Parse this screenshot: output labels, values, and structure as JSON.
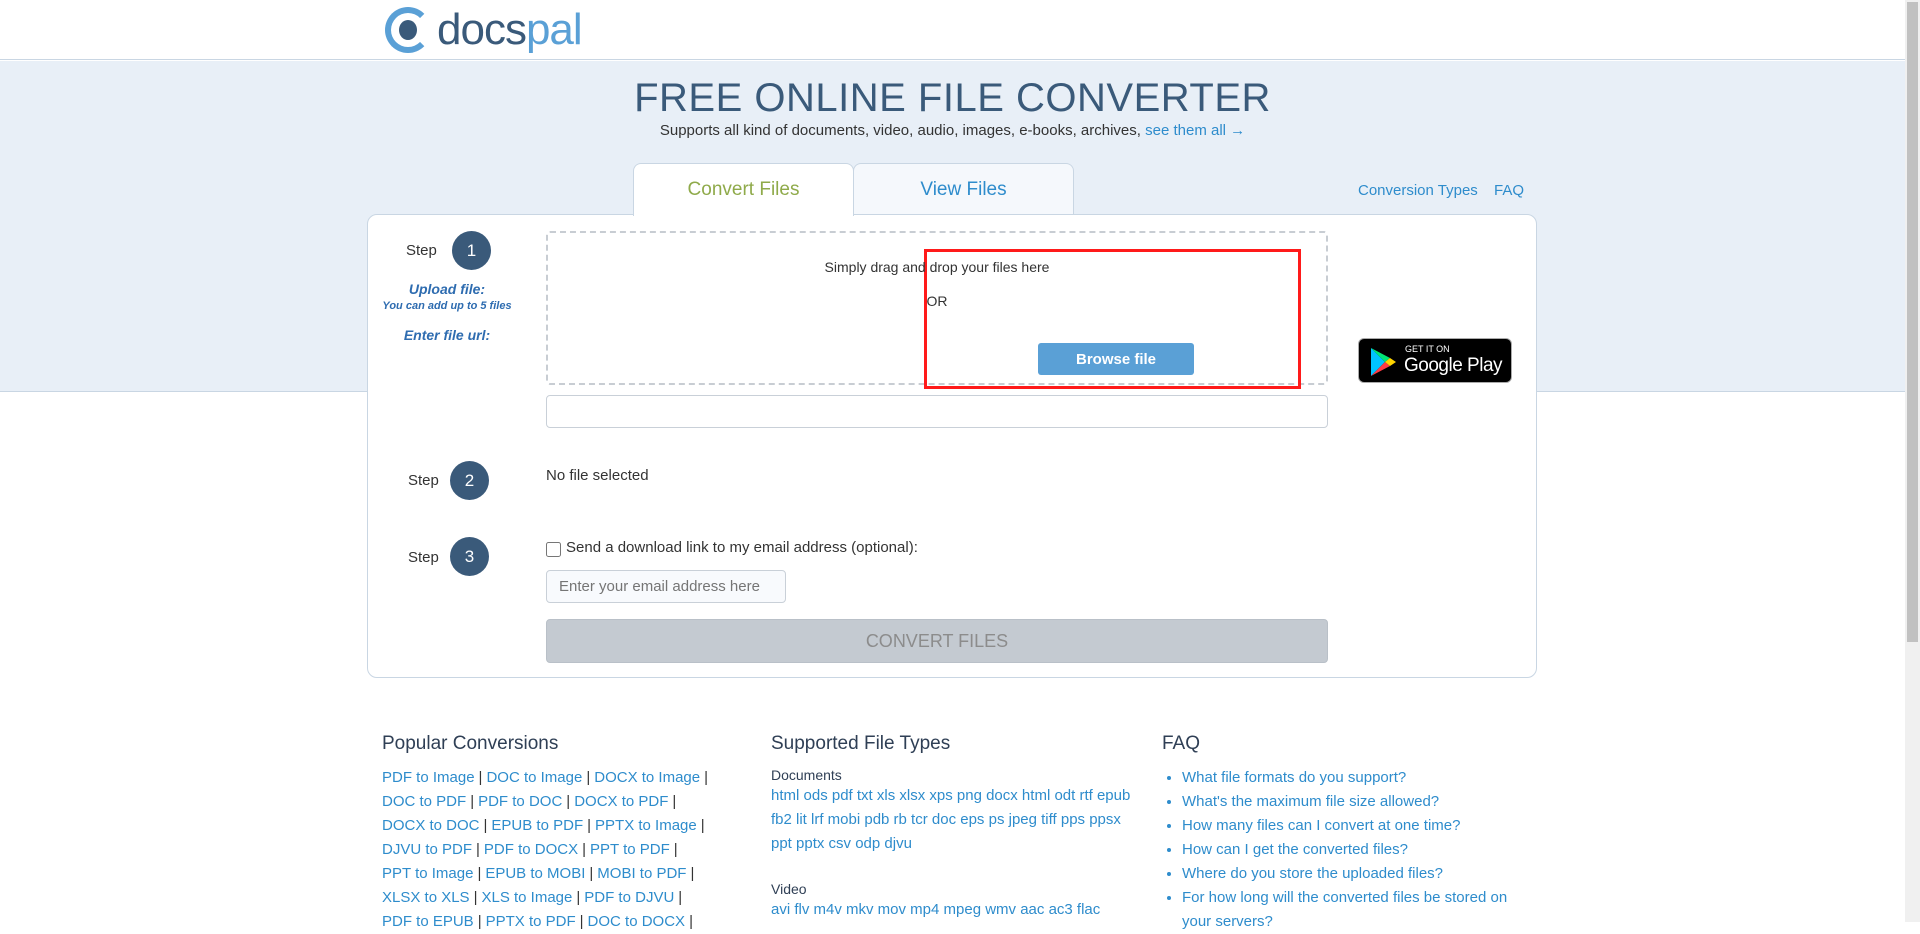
{
  "header": {
    "logo_text_dark": "docs",
    "logo_text_light": "pal"
  },
  "hero": {
    "title": "FREE ONLINE FILE CONVERTER",
    "subtitle": "Supports all kind of documents, video, audio, images, e-books, archives,",
    "see_all": "see them all →"
  },
  "tabs": [
    {
      "label": "Convert Files",
      "active": true
    },
    {
      "label": "View Files",
      "active": false
    }
  ],
  "top_links": [
    "Conversion Types",
    "FAQ"
  ],
  "steps": {
    "step_label": "Step",
    "numbers": [
      "1",
      "2",
      "3"
    ],
    "upload_label": "Upload file:",
    "upload_hint": "You can add up to 5 files",
    "drop_text": "Simply drag and drop your files here",
    "or_text": "OR",
    "browse_label": "Browse file",
    "url_label": "Enter file url:",
    "url_value": "",
    "no_file": "No file selected",
    "email_checkbox_label": "Send a download link to my email address (optional):",
    "email_checked": false,
    "email_placeholder": "Enter your email address here",
    "convert_label": "CONVERT FILES"
  },
  "google_play": {
    "small": "GET IT ON",
    "big": "Google Play"
  },
  "popular": {
    "heading": "Popular Conversions",
    "items": [
      "PDF to Image",
      "DOC to Image",
      "DOCX to Image",
      "DOC to PDF",
      "PDF to DOC",
      "DOCX to PDF",
      "DOCX to DOC",
      "EPUB to PDF",
      "PPTX to Image",
      "DJVU to PDF",
      "PDF to DOCX",
      "PPT to PDF",
      "PPT to Image",
      "EPUB to MOBI",
      "MOBI to PDF",
      "XLSX to XLS",
      "XLS to Image",
      "PDF to DJVU",
      "PDF to EPUB",
      "PPTX to PDF",
      "DOC to DOCX"
    ]
  },
  "file_types": {
    "heading": "Supported File Types",
    "documents_label": "Documents",
    "documents": "html ods pdf txt xls xlsx xps png docx html odt rtf epub fb2 lit lrf mobi pdb rb tcr doc eps ps jpeg tiff pps ppsx ppt pptx csv odp djvu",
    "video_label": "Video",
    "video": "avi flv m4v mkv mov mp4 mpeg wmv aac ac3 flac"
  },
  "faq": {
    "heading": "FAQ",
    "items": [
      "What file formats do you support?",
      "What's the maximum file size allowed?",
      "How many files can I convert at one time?",
      "How can I get the converted files?",
      "Where do you store the uploaded files?",
      "For how long will the converted files be stored on your servers?"
    ]
  },
  "colors": {
    "brand_dark": "#3a5a7a",
    "brand_light": "#5aa0d6",
    "link": "#2e8ccc",
    "highlight": "#ff1a1a"
  }
}
